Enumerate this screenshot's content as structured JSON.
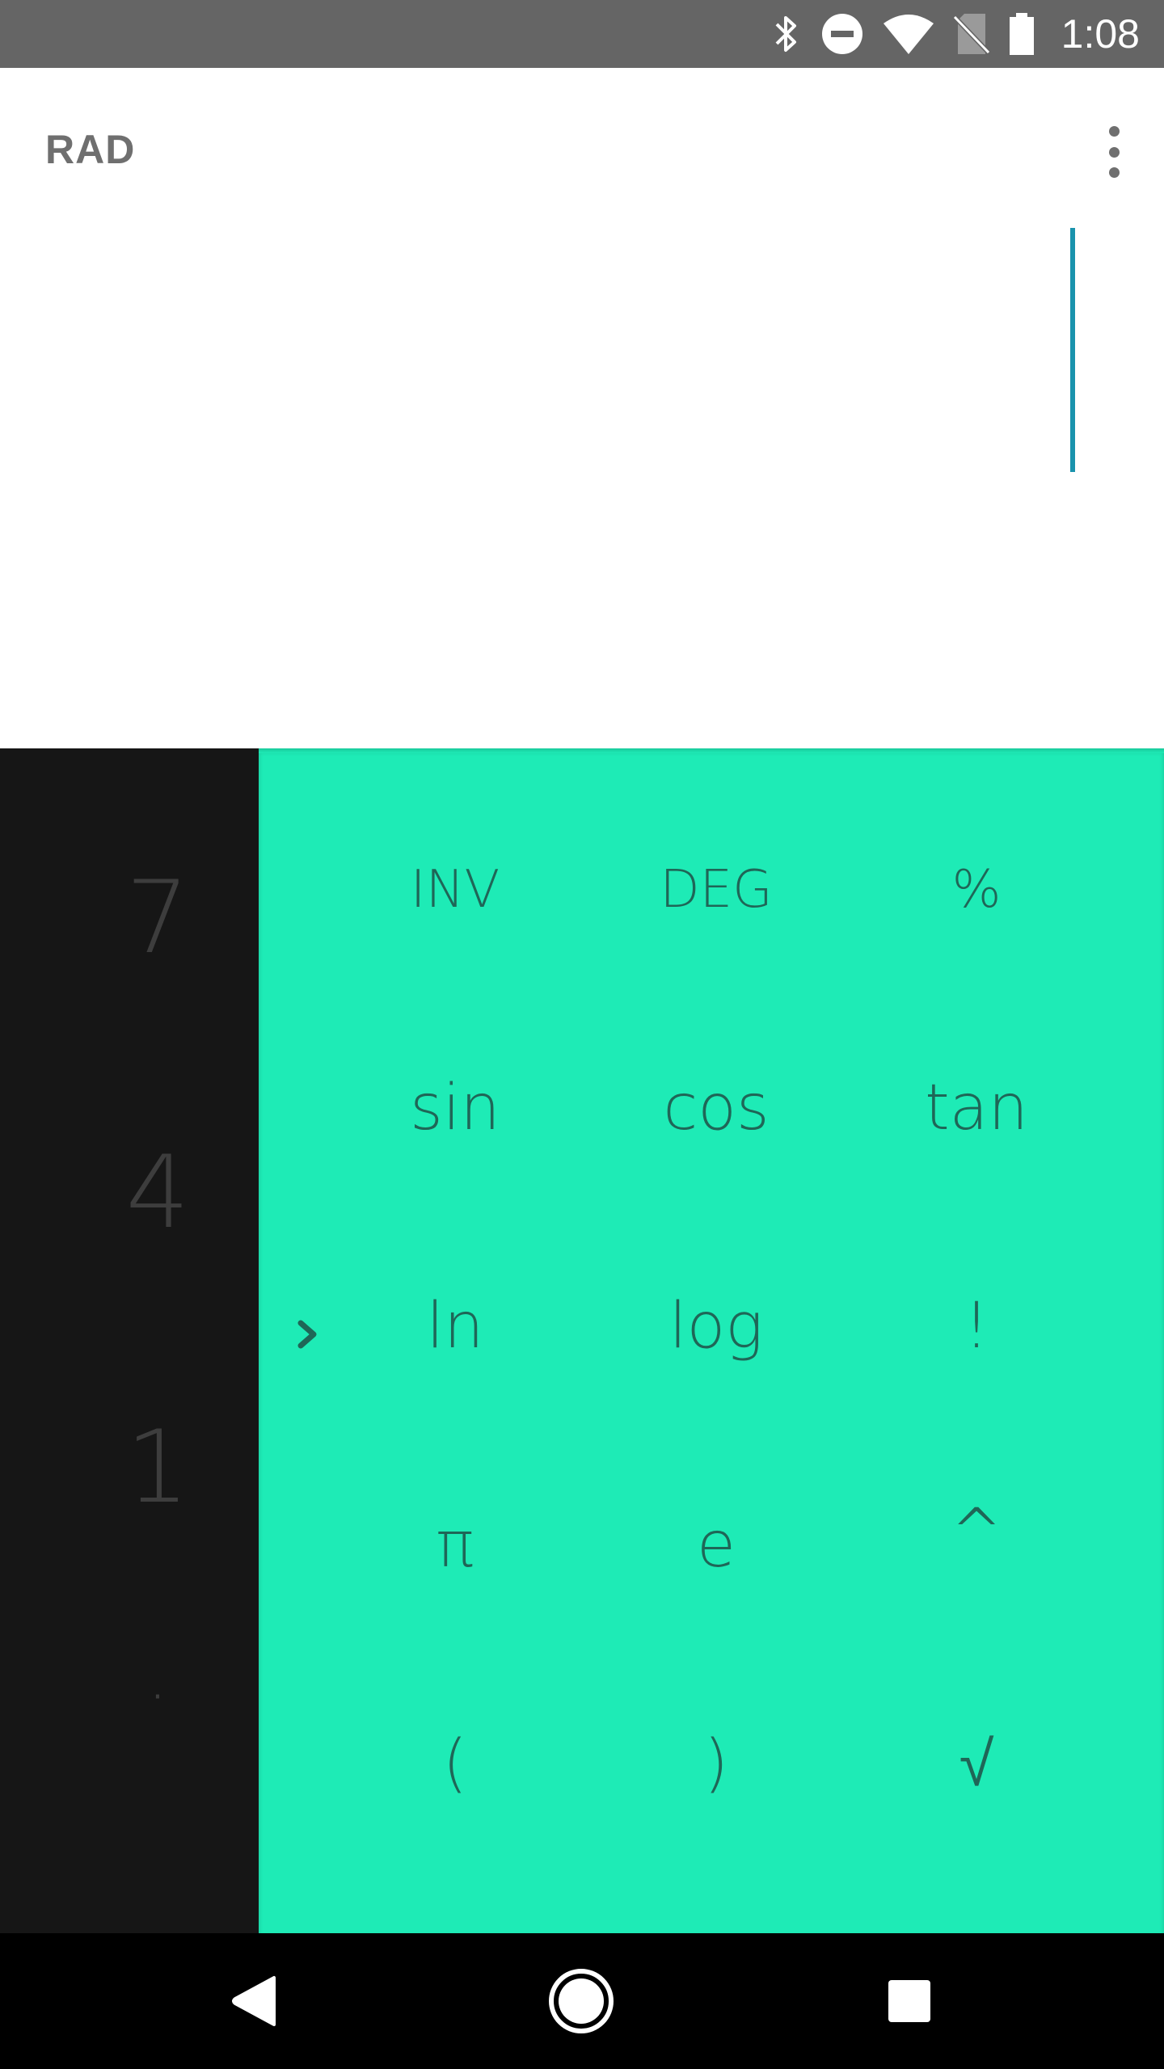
{
  "status_bar": {
    "time": "1:08",
    "icons": [
      "bluetooth-icon",
      "do-not-disturb-icon",
      "wifi-icon",
      "no-sim-icon",
      "battery-icon"
    ]
  },
  "display": {
    "angle_mode": "RAD",
    "menu_icon": "more-vert-icon",
    "cursor_color": "#1a93ad"
  },
  "numeric_pad": {
    "keys": [
      "7",
      "4",
      "1",
      "·"
    ]
  },
  "advanced_pad": {
    "accent": "#1eebb6",
    "text_color": "#1f6657",
    "collapse_icon": "chevron-right-icon",
    "rows": [
      [
        "INV",
        "DEG",
        "%"
      ],
      [
        "sin",
        "cos",
        "tan"
      ],
      [
        "ln",
        "log",
        "!"
      ],
      [
        "π",
        "e",
        "^"
      ],
      [
        "(",
        ")",
        "√"
      ]
    ]
  },
  "nav_bar": {
    "buttons": [
      "back-icon",
      "home-icon",
      "recents-icon"
    ]
  }
}
